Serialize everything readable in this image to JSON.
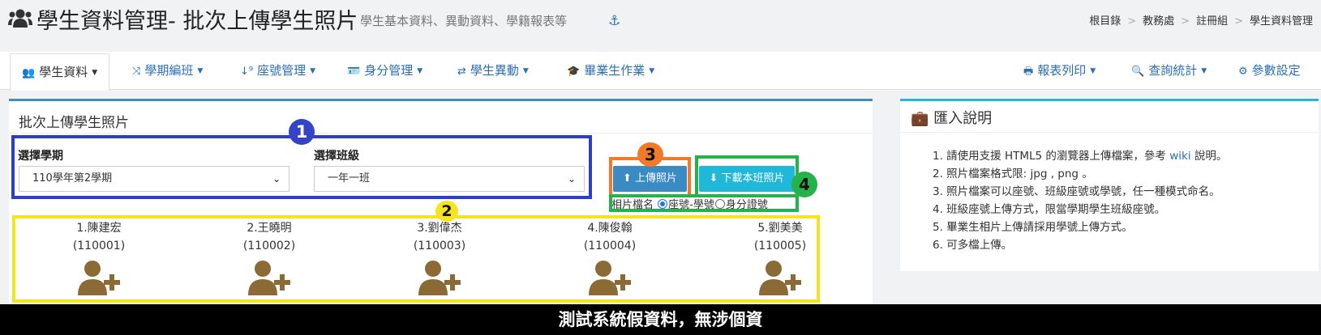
{
  "header": {
    "title": "學生資料管理- 批次上傳學生照片",
    "subtitle": "學生基本資料、異動資料、學籍報表等",
    "anchor_icon": "anchor-icon",
    "breadcrumb": [
      "根目錄",
      "教務處",
      "註冊組",
      "學生資料管理"
    ]
  },
  "menu": {
    "left": [
      {
        "label": "學生資料",
        "icon": "users-icon",
        "active": true
      },
      {
        "label": "學期編班",
        "icon": "shuffle-icon"
      },
      {
        "label": "座號管理",
        "icon": "sort-numeric-icon"
      },
      {
        "label": "身分管理",
        "icon": "id-card-icon"
      },
      {
        "label": "學生異動",
        "icon": "exchange-icon"
      },
      {
        "label": "畢業生作業",
        "icon": "graduation-cap-icon"
      }
    ],
    "right": [
      {
        "label": "報表列印",
        "icon": "print-icon"
      },
      {
        "label": "查詢統計",
        "icon": "search-icon"
      },
      {
        "label": "參數設定",
        "icon": "gear-icon"
      }
    ]
  },
  "upload_panel": {
    "title": "批次上傳學生照片",
    "semester_label": "選擇學期",
    "semester_value": "110學年第2學期",
    "class_label": "選擇班級",
    "class_value": "一年一班",
    "upload_button": "上傳照片",
    "download_button": "下載本班照片",
    "naming_label": "相片檔名",
    "naming_options": [
      {
        "label": "座號-學號",
        "checked": true
      },
      {
        "label": "身分證號",
        "checked": false
      }
    ],
    "students": [
      {
        "name": "1.陳建宏",
        "id": "(110001)"
      },
      {
        "name": "2.王曉明",
        "id": "(110002)"
      },
      {
        "name": "3.劉偉杰",
        "id": "(110003)"
      },
      {
        "name": "4.陳俊翰",
        "id": "(110004)"
      },
      {
        "name": "5.劉美美",
        "id": "(110005)"
      }
    ],
    "student_icon": "user-plus-icon"
  },
  "annotations": {
    "badge1": "1",
    "badge2": "2",
    "badge3": "3",
    "badge4": "4"
  },
  "import_panel": {
    "title": "匯入說明",
    "items": [
      {
        "pre": "1. 請使用支援 HTML5 的瀏覽器上傳檔案，參考 ",
        "link": "wiki",
        "post": " 說明。"
      },
      {
        "pre": "2. 照片檔案格式限: jpg , png 。"
      },
      {
        "pre": "3. 照片檔案可以座號、班級座號或學號，任一種模式命名。"
      },
      {
        "pre": "4. 班級座號上傳方式，限當學期學生班級座號。"
      },
      {
        "pre": "5. 畢業生相片上傳請採用學號上傳方式。"
      },
      {
        "pre": "6. 可多檔上傳。"
      }
    ]
  },
  "footer": {
    "text": "測試系統假資料，無涉個資"
  },
  "colors": {
    "primary": "#3a8ac4",
    "info": "#1fb8d8",
    "annotation_blue": "#2e3fbf",
    "annotation_yellow": "#f5e51f",
    "annotation_orange": "#f0792a",
    "annotation_green": "#26b24b",
    "student_icon": "#8b6a35"
  }
}
